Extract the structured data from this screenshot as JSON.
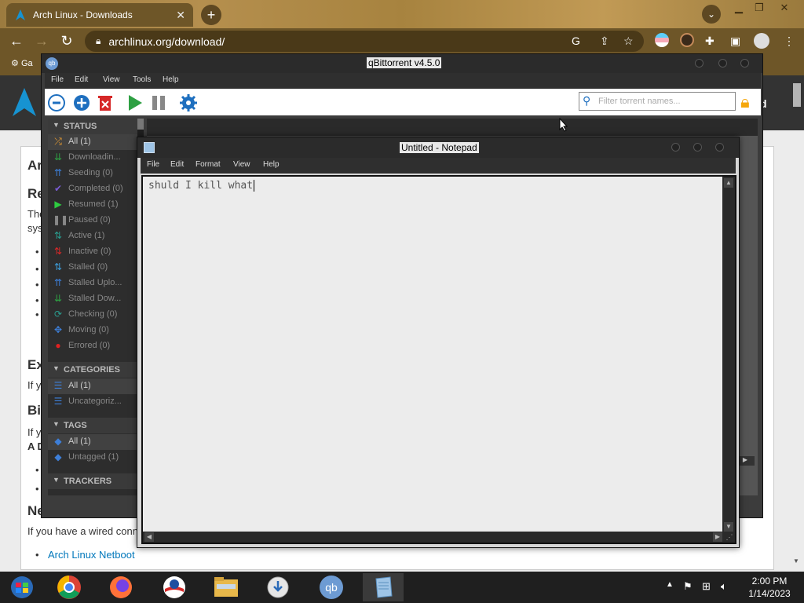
{
  "browser": {
    "tab_title": "Arch Linux - Downloads",
    "tab_close": "✕",
    "new_tab": "+",
    "url": "archlinux.org/download/",
    "bookmark": "Ga",
    "profile_chevron": "⌄"
  },
  "webpage": {
    "header_fragment": "d",
    "fragments": [
      {
        "id": "h1",
        "text": "Ar"
      },
      {
        "id": "h2",
        "text": "Re"
      },
      {
        "id": "p1",
        "text": "The"
      },
      {
        "id": "p2",
        "text": "sys"
      },
      {
        "id": "h3",
        "text": "Ex"
      },
      {
        "id": "p3",
        "text": "If y"
      },
      {
        "id": "h4",
        "text": "Bi"
      },
      {
        "id": "p4",
        "text": "If y"
      },
      {
        "id": "p5",
        "text": "A D"
      },
      {
        "id": "h5",
        "text": "Ne"
      }
    ],
    "wired_text": "If you have a wired conn",
    "netboot_link": "Arch Linux Netboot"
  },
  "qbittorrent": {
    "title": "qBittorrent v4.5.0",
    "menu": [
      "File",
      "Edit",
      "View",
      "Tools",
      "Help"
    ],
    "search_placeholder": "Filter torrent names...",
    "status_header": "STATUS",
    "status_items": [
      {
        "label": "All (1)",
        "icon": "shuffle-icon",
        "color": "#f0a030",
        "glyph": "⤮"
      },
      {
        "label": "Downloadin...",
        "icon": "download-icon",
        "color": "#2ea043",
        "glyph": "⇊"
      },
      {
        "label": "Seeding (0)",
        "icon": "seeding-icon",
        "color": "#3d7fd9",
        "glyph": "⇈"
      },
      {
        "label": "Completed (0)",
        "icon": "check-icon",
        "color": "#7a5cd6",
        "glyph": "✔"
      },
      {
        "label": "Resumed (1)",
        "icon": "play-icon",
        "color": "#2ecc40",
        "glyph": "▶"
      },
      {
        "label": "Paused (0)",
        "icon": "pause-icon",
        "color": "#888888",
        "glyph": "❚❚"
      },
      {
        "label": "Active (1)",
        "icon": "active-icon",
        "color": "#2a9d8f",
        "glyph": "⇅"
      },
      {
        "label": "Inactive (0)",
        "icon": "inactive-icon",
        "color": "#d62828",
        "glyph": "⇅"
      },
      {
        "label": "Stalled (0)",
        "icon": "stalled-icon",
        "color": "#3d9dd9",
        "glyph": "⇅"
      },
      {
        "label": "Stalled Uplo...",
        "icon": "stalled-upload-icon",
        "color": "#3d7fd9",
        "glyph": "⇈"
      },
      {
        "label": "Stalled Dow...",
        "icon": "stalled-download-icon",
        "color": "#2ea043",
        "glyph": "⇊"
      },
      {
        "label": "Checking (0)",
        "icon": "checking-icon",
        "color": "#2a9d8f",
        "glyph": "⟳"
      },
      {
        "label": "Moving (0)",
        "icon": "moving-icon",
        "color": "#3d7fd9",
        "glyph": "✥"
      },
      {
        "label": "Errored (0)",
        "icon": "error-icon",
        "color": "#e02020",
        "glyph": "●"
      }
    ],
    "categories_header": "CATEGORIES",
    "category_items": [
      {
        "label": "All (1)",
        "icon": "list-icon",
        "color": "#3d7fd9",
        "glyph": "☰"
      },
      {
        "label": "Uncategoriz...",
        "icon": "list-icon",
        "color": "#3d7fd9",
        "glyph": "☰"
      }
    ],
    "tags_header": "TAGS",
    "tag_items": [
      {
        "label": "All (1)",
        "icon": "tag-icon",
        "color": "#3d7fd9",
        "glyph": "◆"
      },
      {
        "label": "Untagged (1)",
        "icon": "tag-icon",
        "color": "#3d7fd9",
        "glyph": "◆"
      }
    ],
    "trackers_header": "TRACKERS"
  },
  "notepad": {
    "title": "Untitled - Notepad",
    "menu": [
      "File",
      "Edit",
      "Format",
      "View",
      "Help"
    ],
    "content": "shuld I kill what"
  },
  "taskbar": {
    "time": "2:00 PM",
    "date": "1/14/2023"
  },
  "colors": {
    "arch_blue": "#1793d1",
    "qbt_lock": "#f5a70c"
  }
}
